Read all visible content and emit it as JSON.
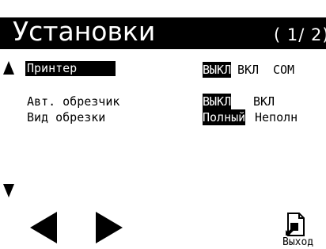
{
  "header": {
    "title": "Установки",
    "page_indicator": "( 1/ 2)"
  },
  "nav_arrows": {
    "scroll_up": "up-triangle",
    "scroll_down": "down-triangle"
  },
  "settings": [
    {
      "label": "Принтер",
      "options": [
        "ВЫКЛ",
        "ВКЛ",
        "COM"
      ],
      "selected": "ВЫКЛ",
      "focused": true
    },
    {
      "label": "Авт. обрезчик",
      "options": [
        "ВЫКЛ",
        "ВКЛ"
      ],
      "selected": "ВЫКЛ",
      "focused": false
    },
    {
      "label": "Вид обрезки",
      "options": [
        "Полный",
        "Неполн"
      ],
      "selected": "Полный",
      "focused": false
    }
  ],
  "footer": {
    "prev_icon": "left-triangle",
    "next_icon": "right-triangle",
    "exit_label": "Выход",
    "exit_icon": "exit-door-icon"
  }
}
